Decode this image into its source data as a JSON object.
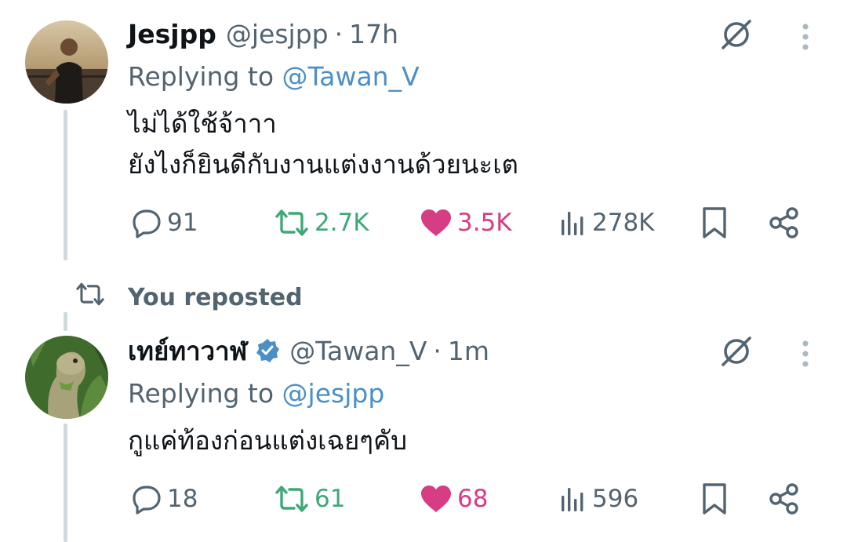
{
  "tweets": [
    {
      "name": "Jesjpp",
      "handle": "@jesjpp",
      "time": "17h",
      "replying_prefix": "Replying to",
      "replying_to": "@Tawan_V",
      "text_lines": [
        "ไม่ได้ใช้จ้าาา",
        "ยังไงก็ยินดีกับงานแต่งงานด้วยนะเต"
      ],
      "replies": "91",
      "reposts": "2.7K",
      "likes": "3.5K",
      "views": "278K"
    },
    {
      "name": "เทย์ทาวาฬ",
      "handle": "@Tawan_V",
      "time": "1m",
      "replying_prefix": "Replying to",
      "replying_to": "@jesjpp",
      "text_lines": [
        "กูแค่ท้องก่อนแต่งเฉยๆคับ"
      ],
      "replies": "18",
      "reposts": "61",
      "likes": "68",
      "views": "596"
    }
  ],
  "repost_label": "You reposted",
  "separator": "·",
  "icons": {
    "grok": "grok-icon",
    "more": "more-vertical-icon",
    "reply": "reply-icon",
    "retweet": "retweet-icon",
    "like": "heart-icon",
    "views": "views-chart-icon",
    "bookmark": "bookmark-icon",
    "share": "share-icon",
    "verified": "verified-badge-icon"
  },
  "colors": {
    "text": "#0f1419",
    "secondary": "#536471",
    "link": "#4c8fc5",
    "retweet": "#3fa877",
    "like": "#d63d85",
    "verified": "#4c8fc5",
    "thread_line": "#cfd9de"
  }
}
